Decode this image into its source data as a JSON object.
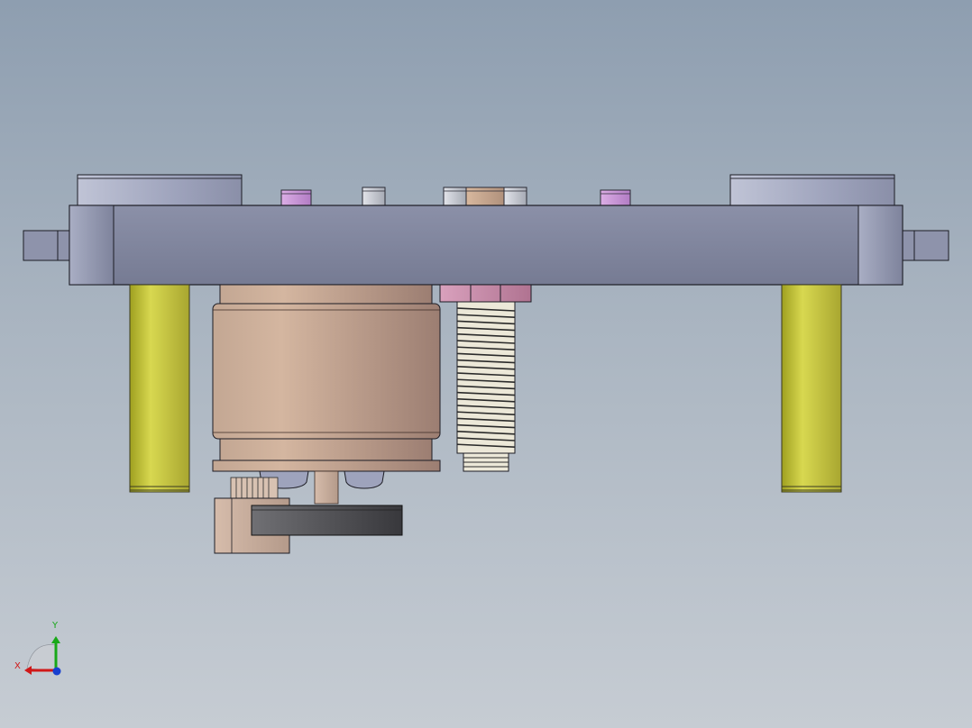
{
  "viewport": {
    "background_top": "#8e9eb0",
    "background_bottom": "#c6ccd3"
  },
  "model": {
    "colors": {
      "base_plate": "#7d829b",
      "guide_pillar": "#c4c240",
      "cylinder_body": "#b99a88",
      "threaded_bolt": "#ece8d8",
      "hex_nut": "#c68aa8",
      "bracket": "#4e4e52",
      "pink_pin": "#c98ed6",
      "gray_pin": "#c4c8d2"
    }
  },
  "triad": {
    "x_label": "X",
    "y_label": "Y",
    "x_color": "#d01818",
    "y_color": "#18a818",
    "z_color": "#1840d0"
  }
}
